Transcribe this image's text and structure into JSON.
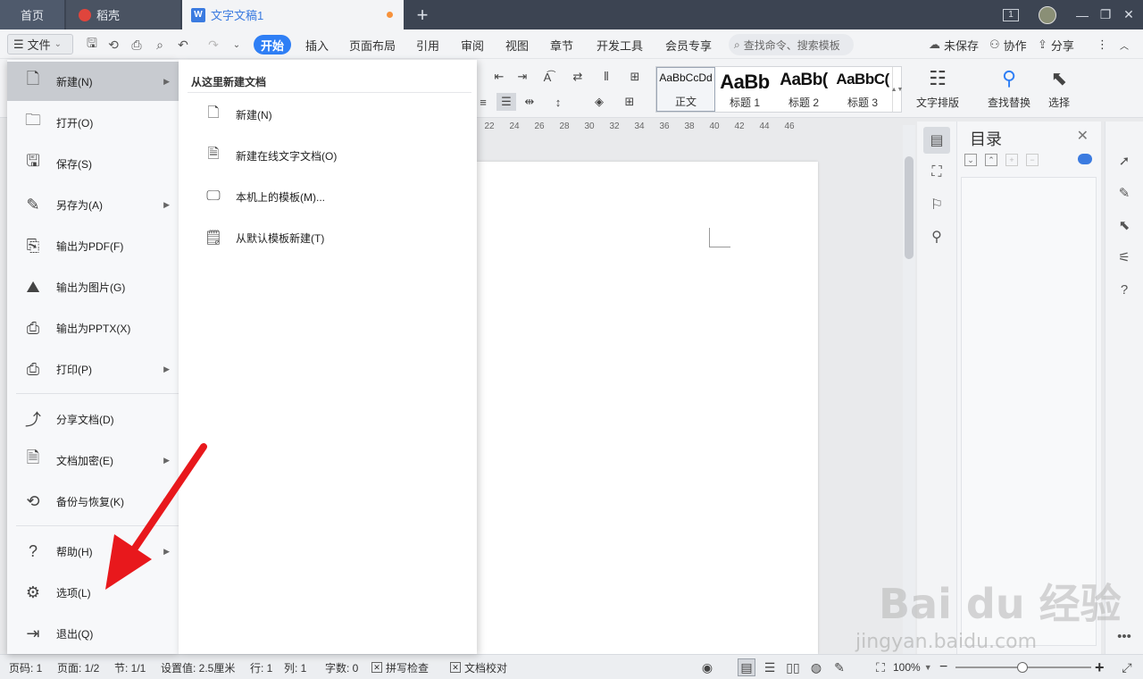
{
  "titlebar": {
    "home_tab": "首页",
    "daoke_tab": "稻壳",
    "doc_tab": "文字文稿1",
    "add_tab": "+",
    "badge": "1"
  },
  "menubar": {
    "file_label": "文件",
    "tabs": [
      "开始",
      "插入",
      "页面布局",
      "引用",
      "审阅",
      "视图",
      "章节",
      "开发工具",
      "会员专享"
    ],
    "search_placeholder": "查找命令、搜索模板",
    "unsaved": "未保存",
    "collab": "协作",
    "share": "分享"
  },
  "ribbon": {
    "styles": [
      {
        "sample": "AaBbCcDd",
        "label": "正文"
      },
      {
        "sample": "AaBb",
        "label": "标题 1"
      },
      {
        "sample": "AaBb(",
        "label": "标题 2"
      },
      {
        "sample": "AaBbC(",
        "label": "标题 3"
      }
    ],
    "text_layout": "文字排版",
    "find_replace": "查找替换",
    "select": "选择"
  },
  "ruler": [
    "22",
    "24",
    "26",
    "28",
    "30",
    "32",
    "34",
    "36",
    "38",
    "40",
    "42",
    "44",
    "46"
  ],
  "toc": {
    "title": "目录"
  },
  "file_menu": {
    "items": [
      {
        "label": "新建(N)",
        "icon": "new-doc-icon",
        "submenu": true
      },
      {
        "label": "打开(O)",
        "icon": "folder-icon",
        "submenu": false
      },
      {
        "label": "保存(S)",
        "icon": "save-icon",
        "submenu": false
      },
      {
        "label": "另存为(A)",
        "icon": "save-as-icon",
        "submenu": true
      },
      {
        "label": "输出为PDF(F)",
        "icon": "pdf-icon",
        "submenu": false
      },
      {
        "label": "输出为图片(G)",
        "icon": "image-icon",
        "submenu": false
      },
      {
        "label": "输出为PPTX(X)",
        "icon": "pptx-icon",
        "submenu": false
      },
      {
        "label": "打印(P)",
        "icon": "print-icon",
        "submenu": true
      },
      {
        "label": "分享文档(D)",
        "icon": "share-icon",
        "submenu": false
      },
      {
        "label": "文档加密(E)",
        "icon": "encrypt-icon",
        "submenu": true
      },
      {
        "label": "备份与恢复(K)",
        "icon": "backup-icon",
        "submenu": true
      },
      {
        "label": "帮助(H)",
        "icon": "help-icon",
        "submenu": true
      },
      {
        "label": "选项(L)",
        "icon": "gear-icon",
        "submenu": false
      },
      {
        "label": "退出(Q)",
        "icon": "exit-icon",
        "submenu": false
      }
    ]
  },
  "new_submenu": {
    "heading": "从这里新建文档",
    "items": [
      "新建(N)",
      "新建在线文字文档(O)",
      "本机上的模板(M)...",
      "从默认模板新建(T)"
    ]
  },
  "status": {
    "page_num": "页码: 1",
    "pages": "页面: 1/2",
    "section": "节: 1/1",
    "setting": "设置值: 2.5厘米",
    "row": "行: 1",
    "col": "列: 1",
    "words": "字数: 0",
    "spell": "拼写检查",
    "proof": "文档校对",
    "zoom": "100%",
    "zoom_out": "−",
    "zoom_in": "+"
  },
  "watermark": {
    "main": "Bai du 经验",
    "sub": "jingyan.baidu.com"
  },
  "colors": {
    "accent": "#2f7ff5",
    "title_bar": "#3c4452",
    "annotation_arrow": "#e8181c"
  }
}
